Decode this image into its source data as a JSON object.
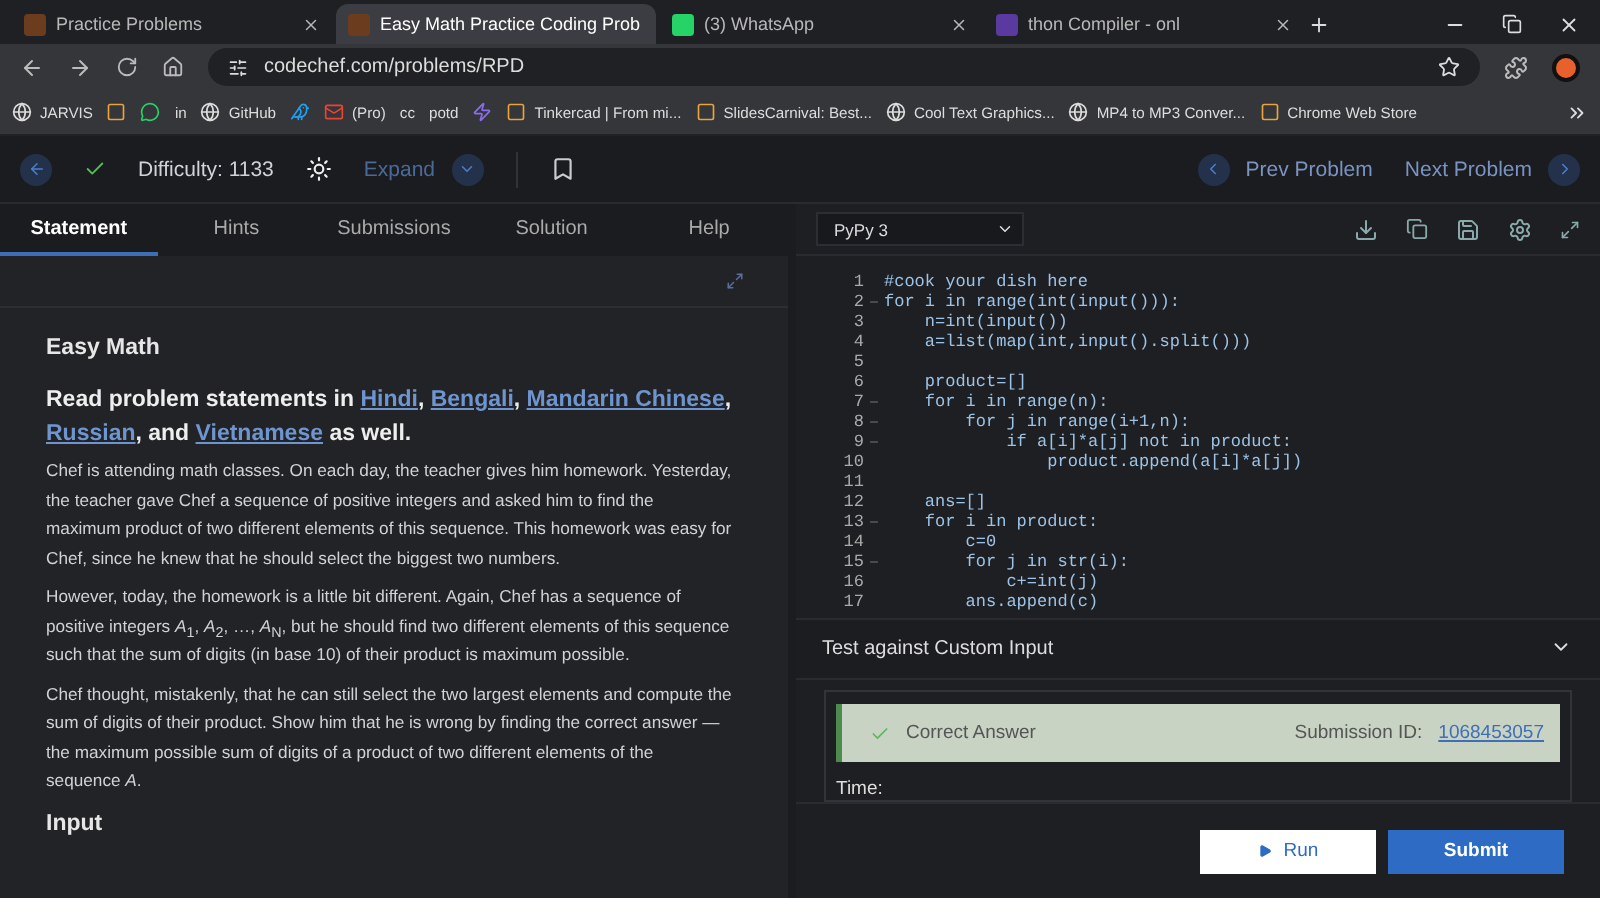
{
  "browser": {
    "tabs": [
      {
        "title": "Practice Problems",
        "selected": false
      },
      {
        "title": "Easy Math Practice Coding Prob",
        "selected": true
      },
      {
        "title": "(3) WhatsApp",
        "selected": false
      },
      {
        "title": "thon Compiler - onl",
        "selected": false
      }
    ],
    "address": "codechef.com/problems/RPD",
    "bookmarks": [
      {
        "kind": "link",
        "label": "JARVIS"
      },
      {
        "kind": "icon"
      },
      {
        "kind": "icon"
      },
      {
        "kind": "link",
        "label": "in"
      },
      {
        "kind": "link",
        "label": "GitHub"
      },
      {
        "kind": "icon"
      },
      {
        "kind": "link",
        "label": "(Pro)"
      },
      {
        "kind": "link",
        "label": "cc"
      },
      {
        "kind": "link",
        "label": "potd"
      },
      {
        "kind": "icon"
      },
      {
        "kind": "link",
        "label": "Tinkercad | From mi..."
      },
      {
        "kind": "link",
        "label": "SlidesCarnival: Best..."
      },
      {
        "kind": "link",
        "label": "Cool Text Graphics..."
      },
      {
        "kind": "link",
        "label": "MP4 to MP3 Conver..."
      },
      {
        "kind": "link",
        "label": "Chrome Web Store"
      }
    ]
  },
  "header": {
    "solved": true,
    "difficulty": "Difficulty: 1133",
    "expand": "Expand",
    "prev": "Prev Problem",
    "next": "Next Problem"
  },
  "tabs": [
    {
      "label": "Statement",
      "selected": true
    },
    {
      "label": "Hints",
      "selected": false
    },
    {
      "label": "Submissions",
      "selected": false
    },
    {
      "label": "Solution",
      "selected": false
    },
    {
      "label": "Help",
      "selected": false
    }
  ],
  "statement": {
    "title": "Easy Math",
    "languages_heading": [
      "Read problem statements in ",
      {
        "link": "Hindi"
      },
      ", ",
      {
        "link": "Bengali"
      },
      ", ",
      {
        "link": "Mandarin Chinese"
      },
      ", ",
      {
        "link": "Russian"
      },
      ", and ",
      {
        "link": "Vietnamese"
      },
      " as well."
    ],
    "paragraphs": [
      "Chef is attending math classes. On each day, the teacher gives him homework. Yesterday, the teacher gave Chef a sequence of positive integers and asked him to find the maximum product of two different elements of this sequence. This homework was easy for Chef, since he knew that he should select the biggest two numbers.",
      "However, today, the homework is a little bit different. Again, Chef has a sequence of positive integers *A*$_{1}$, *A*$_{2}$, …, *A*$_{N}$, but he should find two different elements of this sequence such that the sum of digits (in base 10) of their product is maximum possible.",
      "Chef thought, mistakenly, that he can still select the two largest elements and compute the sum of digits of their product. Show him that he is wrong by finding the correct answer — the maximum possible sum of digits of a product of two different elements of the sequence *A*."
    ],
    "section": "Input"
  },
  "editor": {
    "language": "PyPy 3",
    "lines": [
      {
        "n": "1",
        "code": "#cook your dish here",
        "foldable": false
      },
      {
        "n": "2",
        "code": "for i in range(int(input())):",
        "foldable": true
      },
      {
        "n": "3",
        "code": "    n=int(input())",
        "foldable": false
      },
      {
        "n": "4",
        "code": "    a=list(map(int,input().split()))",
        "foldable": false
      },
      {
        "n": "5",
        "foldable": false
      },
      {
        "n": "6",
        "code": "    product=[]",
        "foldable": false
      },
      {
        "n": "7",
        "code": "    for i in range(n):",
        "foldable": true
      },
      {
        "n": "8",
        "code": "        for j in range(i+1,n):",
        "foldable": true
      },
      {
        "n": "9",
        "code": "            if a[i]*a[j] not in product:",
        "foldable": true
      },
      {
        "n": "10",
        "code": "                product.append(a[i]*a[j])",
        "foldable": false
      },
      {
        "n": "11",
        "foldable": false
      },
      {
        "n": "12",
        "code": "    ans=[]",
        "foldable": false
      },
      {
        "n": "13",
        "code": "    for i in product:",
        "foldable": true
      },
      {
        "n": "14",
        "code": "        c=0",
        "foldable": false
      },
      {
        "n": "15",
        "code": "        for j in str(i):",
        "foldable": true
      },
      {
        "n": "16",
        "code": "            c+=int(j)",
        "foldable": false
      },
      {
        "n": "17",
        "code": "        ans.append(c)",
        "foldable": false
      }
    ]
  },
  "custom_input": {
    "title": "Test against Custom Input",
    "expanded": false
  },
  "result": {
    "verdict": "Correct Answer",
    "correct": true,
    "submission_label": "Submission ID:",
    "submission_id": "1068453057",
    "time_label": "Time:"
  },
  "actions": {
    "run": "Run",
    "submit": "Submit"
  }
}
